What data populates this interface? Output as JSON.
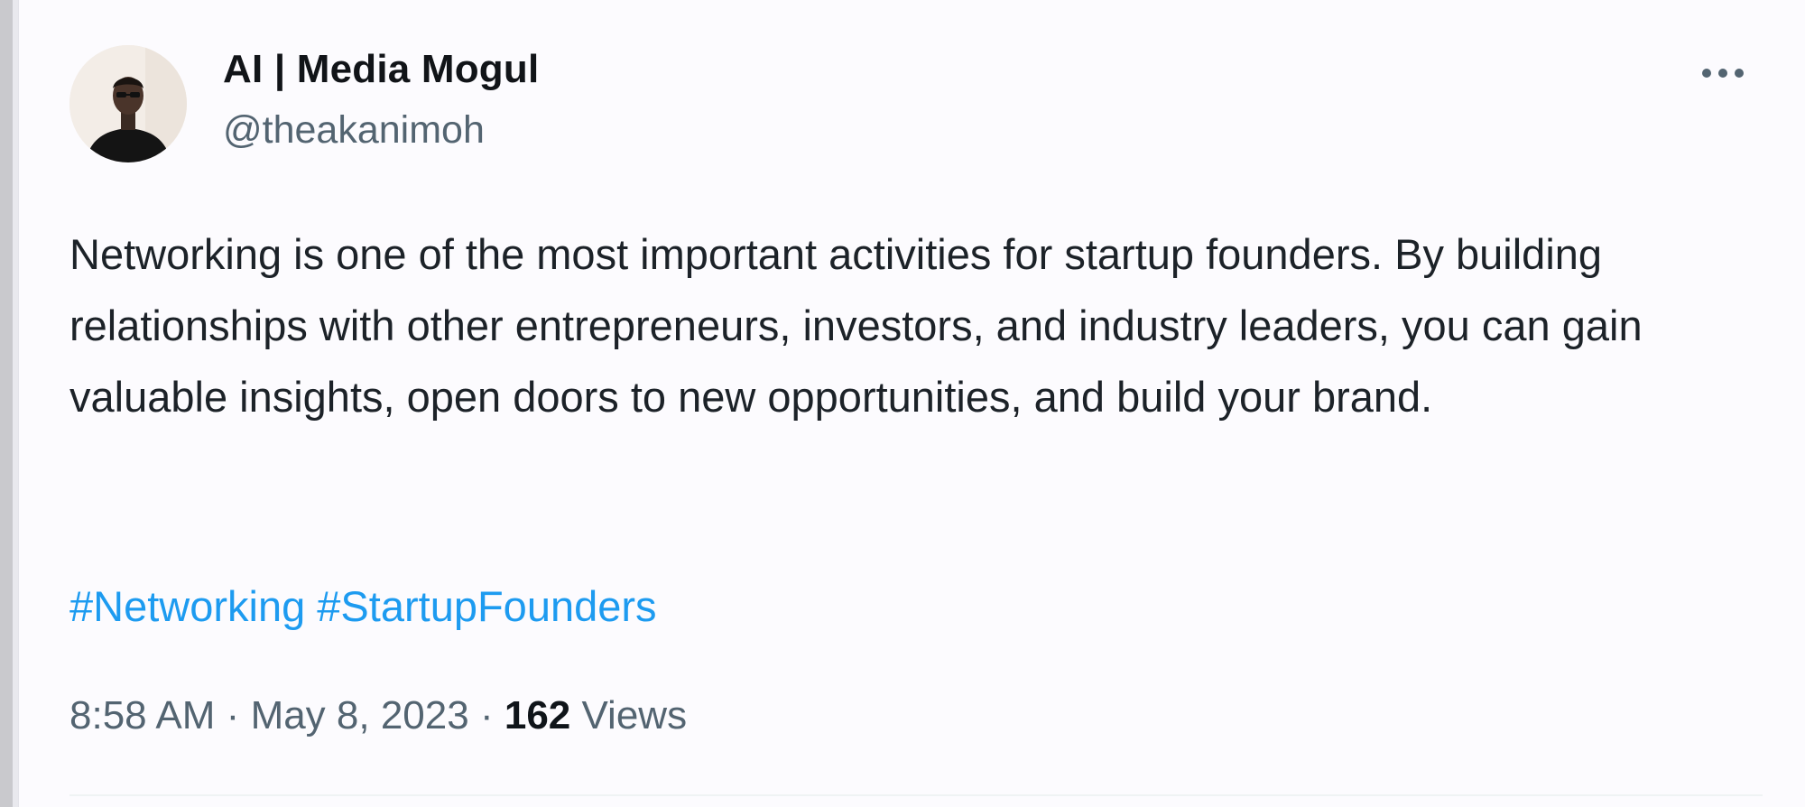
{
  "tweet": {
    "author": {
      "display_name": "AI | Media Mogul",
      "handle": "@theakanimoh",
      "avatar_icon": "profile-photo"
    },
    "more_icon": "ellipsis-icon",
    "text": "Networking is one of the most important activities for startup founders. By building relationships with other entrepreneurs, investors, and industry leaders, you can gain valuable insights, open doors to new opportunities, and build your brand.",
    "hashtags": [
      "#Networking",
      "#StartupFounders"
    ],
    "meta": {
      "time": "8:58 AM",
      "separator": "·",
      "date": "May 8, 2023",
      "views_count": "162",
      "views_label": "Views"
    }
  },
  "colors": {
    "text_primary": "#0f1419",
    "text_secondary": "#536471",
    "link": "#1d9bf0",
    "background": "#fcfbfe"
  }
}
